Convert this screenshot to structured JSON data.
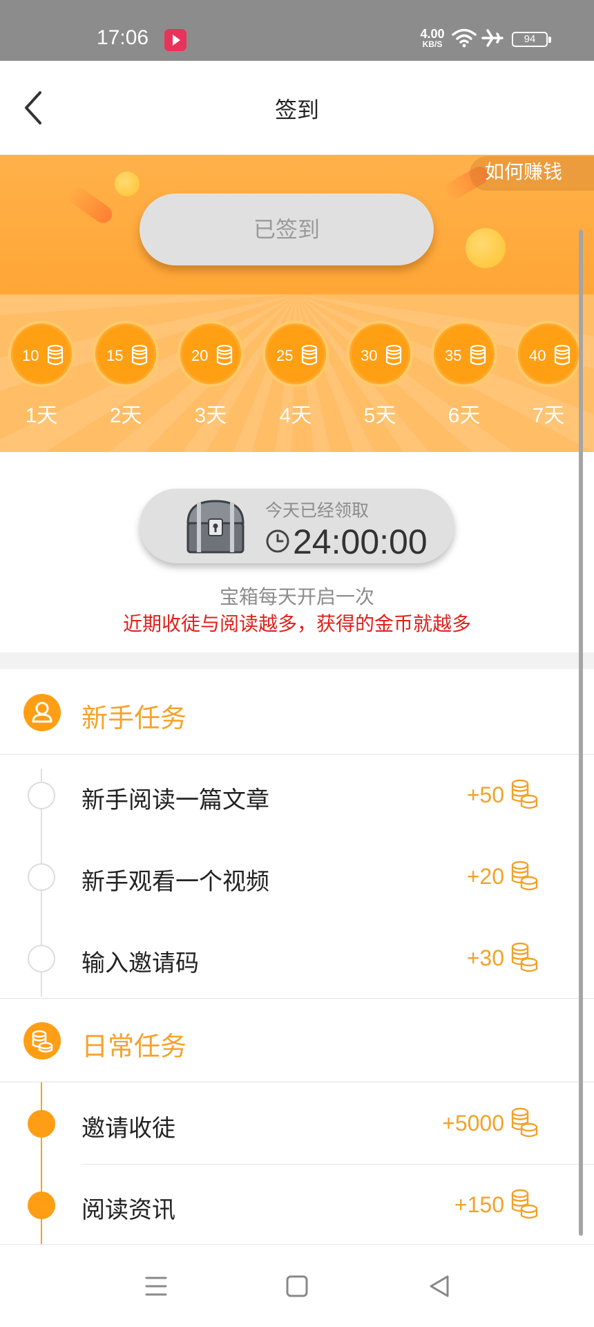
{
  "status_bar": {
    "time": "17:06",
    "net_speed": "4.00",
    "net_unit": "KB/S",
    "battery": "94",
    "icons": [
      "video-app-icon",
      "wifi-icon",
      "airplane-mode-icon",
      "battery-icon"
    ]
  },
  "header": {
    "title": "签到",
    "back_icon": "chevron-left-icon"
  },
  "banner": {
    "earn_link": "如何赚钱",
    "signed_button": "已签到",
    "days": [
      {
        "amount": "10",
        "label": "1天"
      },
      {
        "amount": "15",
        "label": "2天"
      },
      {
        "amount": "20",
        "label": "3天"
      },
      {
        "amount": "25",
        "label": "4天"
      },
      {
        "amount": "30",
        "label": "5天"
      },
      {
        "amount": "35",
        "label": "6天"
      },
      {
        "amount": "40",
        "label": "7天"
      }
    ]
  },
  "chest": {
    "status": "今天已经领取",
    "timer": "24:00:00",
    "note": "宝箱每天开启一次",
    "highlight": "近期收徒与阅读越多，获得的金币就越多"
  },
  "newbie_tasks": {
    "title": "新手任务",
    "icon": "user-icon",
    "items": [
      {
        "name": "新手阅读一篇文章",
        "reward": "+50"
      },
      {
        "name": "新手观看一个视频",
        "reward": "+20"
      },
      {
        "name": "输入邀请码",
        "reward": "+30"
      }
    ]
  },
  "daily_tasks": {
    "title": "日常任务",
    "icon": "coins-icon",
    "items": [
      {
        "name": "邀请收徒",
        "reward": "+5000"
      },
      {
        "name": "阅读资讯",
        "reward": "+150"
      }
    ]
  },
  "nav": {
    "icons": [
      "menu-icon",
      "home-square-icon",
      "back-triangle-icon"
    ]
  },
  "colors": {
    "accent": "#ff9e15",
    "accent_text": "#f6a22a",
    "banner": "#ffb14a",
    "highlight_red": "#e0201a"
  }
}
